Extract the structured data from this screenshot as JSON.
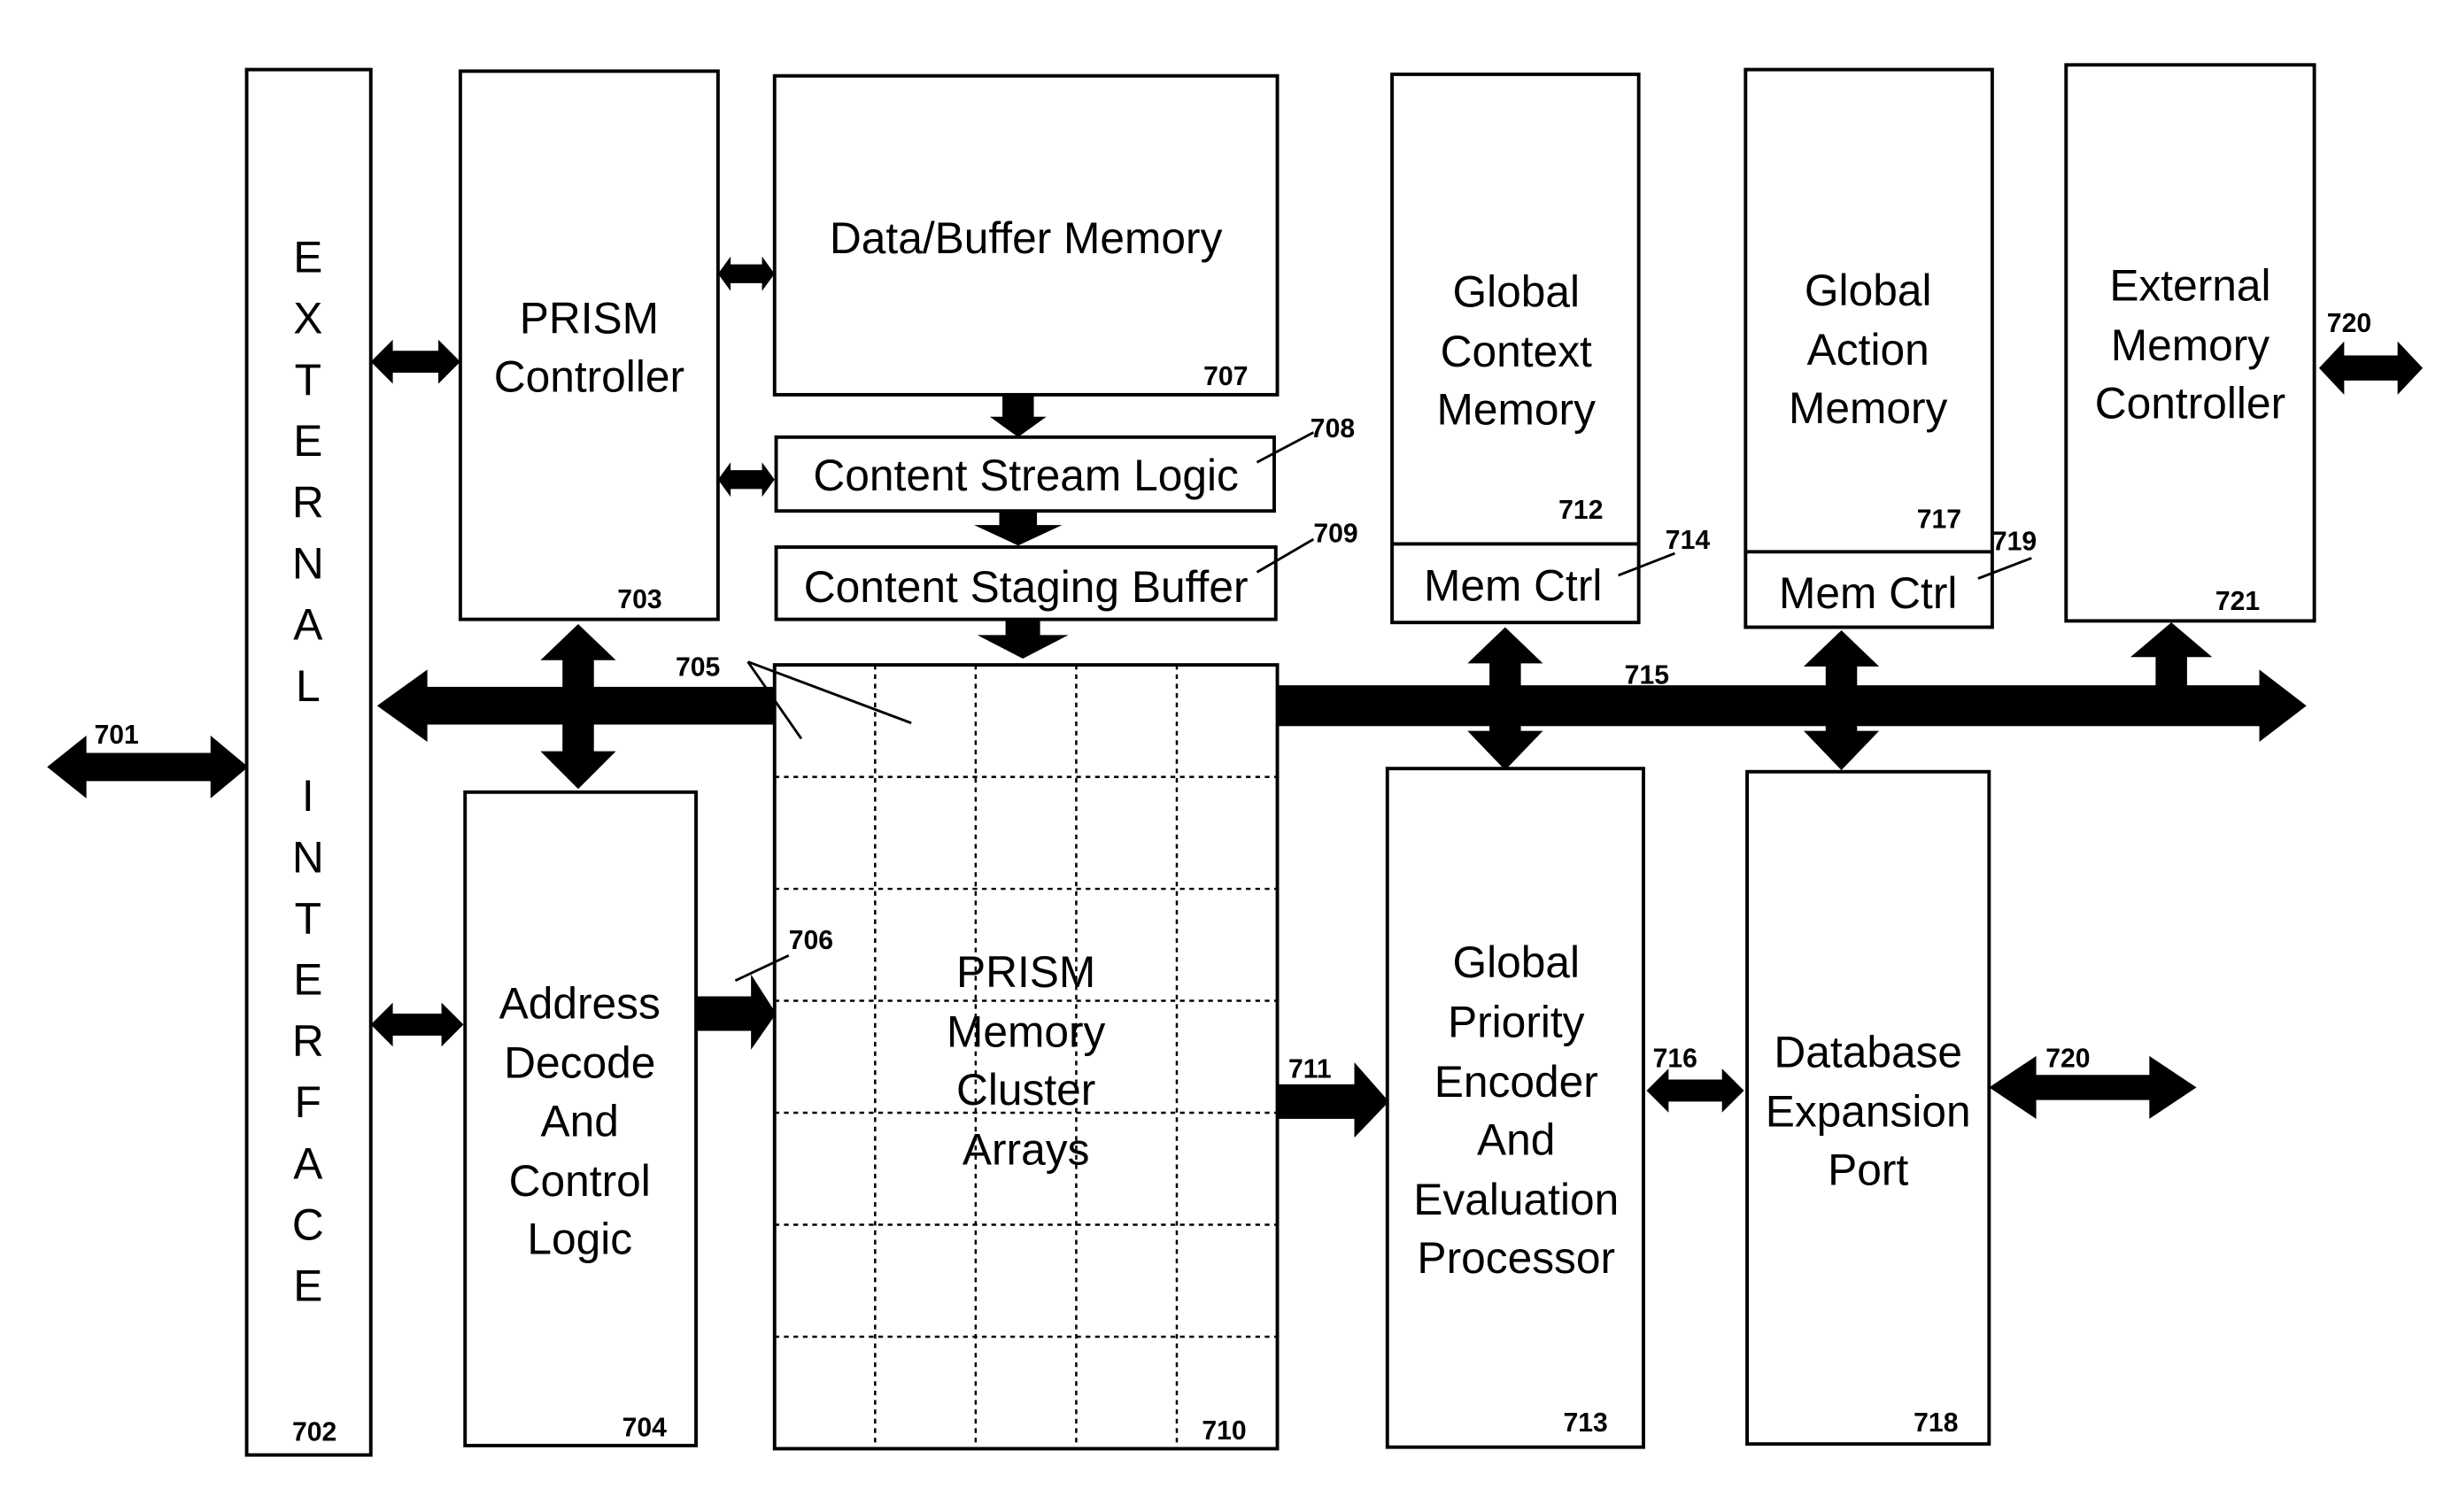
{
  "figure": {
    "blocks": {
      "external_interface": {
        "letters_top": [
          "E",
          "X",
          "T",
          "E",
          "R",
          "N",
          "A",
          "L"
        ],
        "letters_bottom": [
          "I",
          "N",
          "T",
          "E",
          "R",
          "F",
          "A",
          "C",
          "E"
        ],
        "ref": "702"
      },
      "prism_controller": {
        "lines": [
          "PRISM",
          "Controller"
        ],
        "ref": "703"
      },
      "address_decode": {
        "lines": [
          "Address",
          "Decode",
          "And",
          "Control",
          "Logic"
        ],
        "ref": "704"
      },
      "data_buffer_memory": {
        "lines": [
          "Data/Buffer Memory"
        ],
        "ref": "707"
      },
      "content_stream_logic": {
        "lines": [
          "Content Stream Logic"
        ],
        "ref": "708"
      },
      "content_staging_buffer": {
        "lines": [
          "Content Staging Buffer"
        ],
        "ref": "709"
      },
      "memory_cluster_arrays": {
        "lines": [
          "PRISM",
          "Memory",
          "Cluster",
          "Arrays"
        ],
        "ref": "710",
        "grid_columns": 5,
        "grid_rows": 7
      },
      "global_context_memory": {
        "lines": [
          "Global",
          "Context",
          "Memory"
        ],
        "ref": "712",
        "mem_ctrl": "Mem Ctrl",
        "mem_ctrl_ref": "714"
      },
      "global_priority_encoder": {
        "lines": [
          "Global",
          "Priority",
          "Encoder",
          "And",
          "Evaluation",
          "Processor"
        ],
        "ref": "713"
      },
      "global_action_memory": {
        "lines": [
          "Global",
          "Action",
          "Memory"
        ],
        "ref": "717",
        "mem_ctrl": "Mem Ctrl",
        "mem_ctrl_ref": "719"
      },
      "database_expansion_port": {
        "lines": [
          "Database",
          "Expansion",
          "Port"
        ],
        "ref": "718"
      },
      "external_memory_controller": {
        "lines": [
          "External",
          "Memory",
          "Controller"
        ],
        "ref": "721"
      }
    },
    "connections": {
      "external_io": "701",
      "bus_left": "705",
      "decode_to_array": "706",
      "array_to_encoder": "711",
      "bus_right": "715",
      "encoder_to_port": "716",
      "port_external": "720",
      "ext_mem_external": "720"
    }
  }
}
